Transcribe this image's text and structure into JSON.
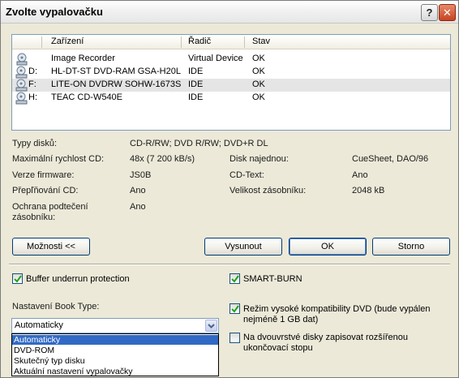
{
  "window": {
    "title": "Zvolte vypalovačku",
    "help_label": "?",
    "close_label": "✕"
  },
  "devices": {
    "columns": [
      "Zařízení",
      "Řadič",
      "Stav"
    ],
    "rows": [
      {
        "letter": "",
        "name": "Image Recorder",
        "controller": "Virtual Device",
        "status": "OK"
      },
      {
        "letter": "D:",
        "name": "HL-DT-ST DVD-RAM GSA-H20L",
        "controller": "IDE",
        "status": "OK"
      },
      {
        "letter": "F:",
        "name": "LITE-ON DVDRW SOHW-1673S",
        "controller": "IDE",
        "status": "OK"
      },
      {
        "letter": "H:",
        "name": "TEAC CD-W540E",
        "controller": "IDE",
        "status": "OK"
      }
    ]
  },
  "info": {
    "disc_types_label": "Typy disků:",
    "disc_types_value": "CD-R/RW; DVD R/RW; DVD+R DL",
    "max_speed_label": "Maximální rychlost CD:",
    "max_speed_value": "48x (7 200 kB/s)",
    "disc_at_once_label": "Disk najednou:",
    "disc_at_once_value": "CueSheet, DAO/96",
    "firmware_label": "Verze firmware:",
    "firmware_value": "JS0B",
    "cd_text_label": "CD-Text:",
    "cd_text_value": "Ano",
    "overburn_label": "Přepľňování CD:",
    "overburn_value": "Ano",
    "buffer_size_label": "Velikost zásobníku:",
    "buffer_size_value": "2048 kB",
    "underrun_label_1": "Ochrana podtečení",
    "underrun_label_2": "zásobníku:",
    "underrun_value": "Ano"
  },
  "buttons": {
    "options": "Možnosti <<",
    "eject": "Vysunout",
    "ok": "OK",
    "cancel": "Storno"
  },
  "options": {
    "buffer_underrun": "Buffer underrun protection",
    "smart_burn": "SMART-BURN",
    "book_type_label": "Nastavení Book Type:",
    "book_type_selected": "Automaticky",
    "book_type_options": [
      "Automaticky",
      "DVD-ROM",
      "Skutečný typ disku",
      "Aktuální nastavení vypalovačky"
    ],
    "dvd_compat": "Režim vysoké kompatibility DVD (bude vypálen nejméně 1 GB dat)",
    "dvd_compat_1": "Režim vysoké kompatibility DVD (bude vypálen",
    "dvd_compat_2": "nejméně 1 GB dat)",
    "dual_layer_1": "Na dvouvrstvé disky zapisovat rozšířenou",
    "dual_layer_2": "ukončovací stopu"
  },
  "states": {
    "buffer_underrun_checked": true,
    "smart_burn_checked": true,
    "dvd_compat_checked": true,
    "dual_layer_checked": false
  }
}
